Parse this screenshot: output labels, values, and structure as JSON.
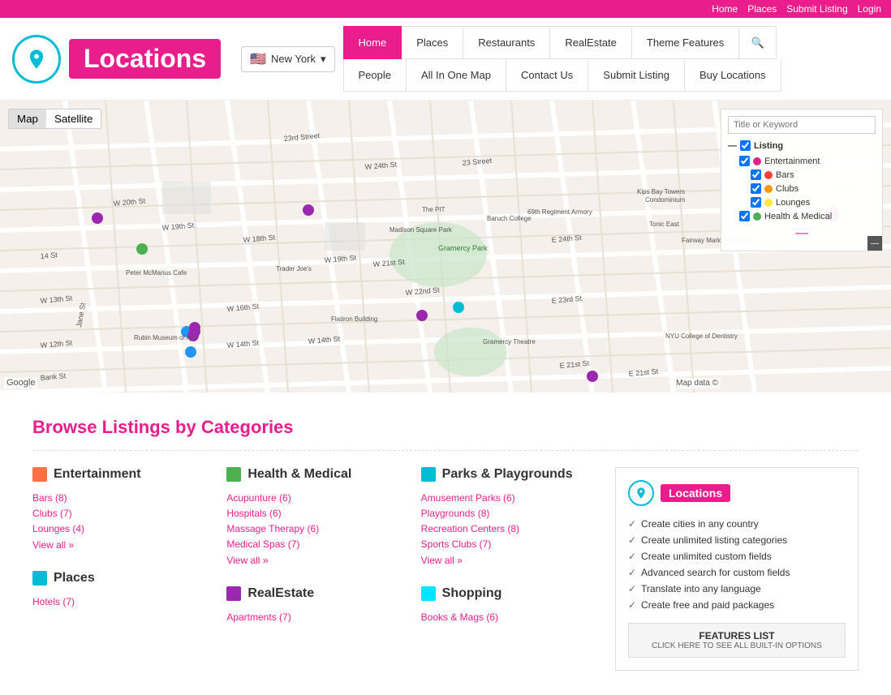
{
  "topbar": {
    "links": [
      "Home",
      "Places",
      "Submit Listing",
      "Login"
    ]
  },
  "header": {
    "logo_text": "Locations",
    "location": "New York",
    "nav": {
      "row1": [
        "Home",
        "Places",
        "Restaurants",
        "RealEstate",
        "Theme Features"
      ],
      "row2": [
        "People",
        "All In One Map",
        "Contact Us",
        "Submit Listing",
        "Buy Locations"
      ]
    },
    "active_nav": "Home"
  },
  "map": {
    "controls": {
      "map_label": "Map",
      "satellite_label": "Satellite"
    },
    "sidebar": {
      "placeholder": "Title or Keyword",
      "listing_label": "Listing",
      "categories": [
        {
          "name": "Entertainment",
          "color": "#e91e8c",
          "checked": true
        },
        {
          "name": "Bars",
          "color": "#f44336",
          "checked": true
        },
        {
          "name": "Clubs",
          "color": "#ff9800",
          "checked": true
        },
        {
          "name": "Lounges",
          "color": "#ffeb3b",
          "checked": true
        },
        {
          "name": "Health & Medical",
          "color": "#4caf50",
          "checked": true
        }
      ]
    },
    "google_label": "Google",
    "map_data_label": "Map data ©"
  },
  "browse": {
    "title": "Browse Listings by Categories",
    "columns": [
      {
        "name": "Entertainment",
        "color": "#ff7043",
        "items": [
          {
            "label": "Bars (8)",
            "href": "#"
          },
          {
            "label": "Clubs (7)",
            "href": "#"
          },
          {
            "label": "Lounges (4)",
            "href": "#"
          }
        ],
        "view_all": "View all »"
      },
      {
        "name": "Health & Medical",
        "color": "#4caf50",
        "items": [
          {
            "label": "Acupunture (6)",
            "href": "#"
          },
          {
            "label": "Hospitals (6)",
            "href": "#"
          },
          {
            "label": "Massage Therapy (6)",
            "href": "#"
          },
          {
            "label": "Medical Spas (7)",
            "href": "#"
          }
        ],
        "view_all": "View all »"
      },
      {
        "name": "Parks & Playgrounds",
        "color": "#00bcd4",
        "items": [
          {
            "label": "Amusement Parks (6)",
            "href": "#"
          },
          {
            "label": "Playgrounds (8)",
            "href": "#"
          },
          {
            "label": "Recreation Centers (8)",
            "href": "#"
          },
          {
            "label": "Sports Clubs (7)",
            "href": "#"
          }
        ],
        "view_all": "View all »"
      }
    ],
    "row2_columns": [
      {
        "name": "Places",
        "color": "#00bcd4",
        "items": [
          {
            "label": "Hotels (7)",
            "href": "#"
          }
        ]
      },
      {
        "name": "RealEstate",
        "color": "#9c27b0",
        "items": [
          {
            "label": "Apartments (7)",
            "href": "#"
          }
        ]
      },
      {
        "name": "Shopping",
        "color": "#00e5ff",
        "items": [
          {
            "label": "Books & Mags (6)",
            "href": "#"
          }
        ]
      }
    ]
  },
  "feature_box": {
    "logo_text": "Locations",
    "features": [
      "Create cities in any country",
      "Create unlimited listing categories",
      "Create unlimited custom fields",
      "Advanced search for custom fields",
      "Translate into any language",
      "Create free and paid packages"
    ],
    "button_label": "FEATURES LIST",
    "button_sub": "click here to see all built-in options"
  }
}
